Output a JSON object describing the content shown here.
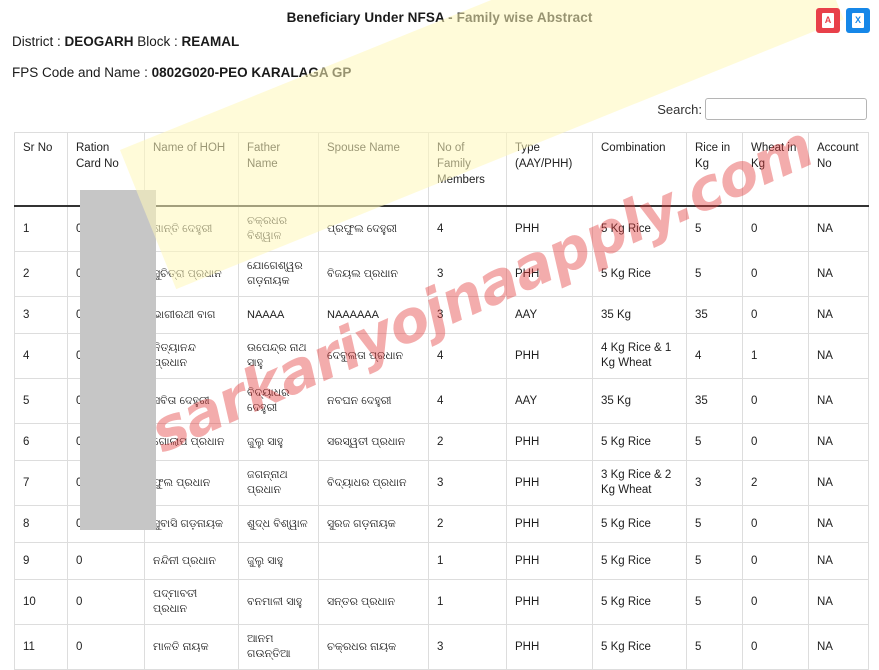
{
  "header": {
    "title": "Beneficiary Under NFSA - Family wise Abstract",
    "district_label": "District : ",
    "district_value": "DEOGARH",
    "block_label": " Block : ",
    "block_value": "REAMAL",
    "fps_label": "FPS Code and Name : ",
    "fps_value": "0802G020-PEO KARALAGA GP"
  },
  "export": {
    "pdf_label": "A",
    "pdf_icon": "pdf-document-icon",
    "pdf_color": "#e8404a",
    "xls_label": "X",
    "xls_icon": "excel-document-icon",
    "xls_color": "#1687e8"
  },
  "search": {
    "label": "Search:",
    "value": "",
    "placeholder": ""
  },
  "watermark": {
    "text": "sarkariyojnaapply.com"
  },
  "table": {
    "columns": [
      "Sr No",
      "Ration Card No",
      "Name of HOH",
      "Father Name",
      "Spouse Name",
      "No of Family Members",
      "Type (AAY/PHH)",
      "Combination",
      "Rice in Kg",
      "Wheat in Kg",
      "Account No"
    ],
    "rows": [
      {
        "sr": "1",
        "ration_card": "0",
        "hoh": "ଶାନ୍ତି ଦେହୁରୀ",
        "father": "ଚକ୍ରଧର ବିଶ୍ୱାଳ",
        "spouse": "ପ୍ରଫୁଲ ଦେହୁରୀ",
        "family": "4",
        "type": "PHH",
        "combination": "5 Kg Rice",
        "rice": "5",
        "wheat": "0",
        "account": "NA"
      },
      {
        "sr": "2",
        "ration_card": "0",
        "hoh": "ସୁଚିତ୍ରା ପ୍ରଧାନ",
        "father": "ଯୋଗେଶ୍ୱର ଗଡ଼ନାୟକ",
        "spouse": "ବିଜୟଲ ପ୍ରଧାନ",
        "family": "3",
        "type": "PHH",
        "combination": "5 Kg Rice",
        "rice": "5",
        "wheat": "0",
        "account": "NA"
      },
      {
        "sr": "3",
        "ration_card": "0",
        "hoh": "ଭାଗୀରଥୀ ବାଗ",
        "father": "NAAAA",
        "spouse": "NAAAAAA",
        "family": "3",
        "type": "AAY",
        "combination": "35 Kg",
        "rice": "35",
        "wheat": "0",
        "account": "NA"
      },
      {
        "sr": "4",
        "ration_card": "0",
        "hoh": "ନିତ୍ୟାନନ୍ଦ ପ୍ରଧାନ",
        "father": "ଉପେନ୍ଦ୍ର ନାଥ ସାହୁ",
        "spouse": "ଦେବୁଲତା ପ୍ରଧାନ",
        "family": "4",
        "type": "PHH",
        "combination": "4 Kg Rice & 1 Kg Wheat",
        "rice": "4",
        "wheat": "1",
        "account": "NA"
      },
      {
        "sr": "5",
        "ration_card": "0",
        "hoh": "ସବିତା ଦେହୁରୀ",
        "father": "ବିଦ୍ୟାଧର ଦେହୁରୀ",
        "spouse": "ନବଘନ ଦେହୁରୀ",
        "family": "4",
        "type": "AAY",
        "combination": "35 Kg",
        "rice": "35",
        "wheat": "0",
        "account": "NA"
      },
      {
        "sr": "6",
        "ration_card": "0",
        "hoh": "ଗୋଲାପ ପ୍ରଧାନ",
        "father": "ଜୁଲୁ ସାହୁ",
        "spouse": "ସରସ୍ୱତୀ ପ୍ରଧାନ",
        "family": "2",
        "type": "PHH",
        "combination": "5 Kg Rice",
        "rice": "5",
        "wheat": "0",
        "account": "NA"
      },
      {
        "sr": "7",
        "ration_card": "0",
        "hoh": "ଫୁଲ ପ୍ରଧାନ",
        "father": "ଜଗନ୍ନାଥ ପ୍ରଧାନ",
        "spouse": "ବିଦ୍ୟାଧର ପ୍ରଧାନ",
        "family": "3",
        "type": "PHH",
        "combination": "3 Kg Rice & 2 Kg Wheat",
        "rice": "3",
        "wheat": "2",
        "account": "NA"
      },
      {
        "sr": "8",
        "ration_card": "0",
        "hoh": "ସୁବାସି ଗଡ଼ନାୟକ",
        "father": "ଶୁଦ୍ଧ ବିଶ୍ୱାଳ",
        "spouse": "ସୁରଜ ଗଡ଼ନାୟକ",
        "family": "2",
        "type": "PHH",
        "combination": "5 Kg Rice",
        "rice": "5",
        "wheat": "0",
        "account": "NA"
      },
      {
        "sr": "9",
        "ration_card": "0",
        "hoh": "ନନ୍ଦିନୀ ପ୍ରଧାନ",
        "father": "ଜୁଲୁ ସାହୁ",
        "spouse": "",
        "family": "1",
        "type": "PHH",
        "combination": "5 Kg Rice",
        "rice": "5",
        "wheat": "0",
        "account": "NA"
      },
      {
        "sr": "10",
        "ration_card": "0",
        "hoh": "ପଦ୍ମାବତୀ ପ୍ରଧାନ",
        "father": "ବନମାଳୀ ସାହୁ",
        "spouse": "ସନ୍ତର ପ୍ରଧାନ",
        "family": "1",
        "type": "PHH",
        "combination": "5 Kg Rice",
        "rice": "5",
        "wheat": "0",
        "account": "NA"
      },
      {
        "sr": "11",
        "ration_card": "0",
        "hoh": "ମାଳତି ନାୟକ",
        "father": "ଆନମ ଗଉନ୍ତିଆ",
        "spouse": "ଚକ୍ରଧର ନାୟକ",
        "family": "3",
        "type": "PHH",
        "combination": "5 Kg Rice",
        "rice": "5",
        "wheat": "0",
        "account": "NA"
      }
    ]
  }
}
